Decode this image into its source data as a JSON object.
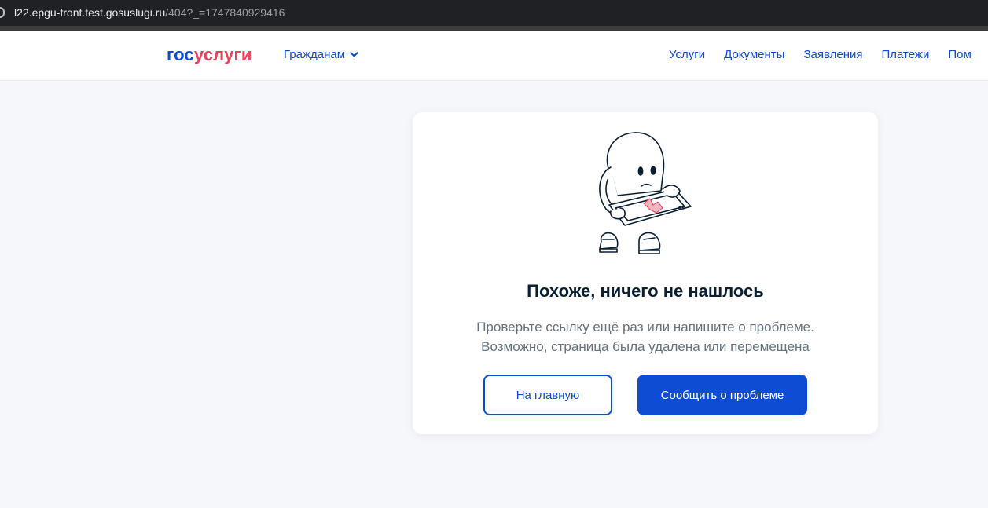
{
  "browser": {
    "url_host": "l22.epgu-front.test.gosuslugi.ru",
    "url_path": "/404?_=1747840929416"
  },
  "header": {
    "logo_part1": "гос",
    "logo_part2": "услуги",
    "citizens_label": "Гражданам",
    "nav": [
      "Услуги",
      "Документы",
      "Заявления",
      "Платежи",
      "Пом"
    ]
  },
  "card": {
    "title": "Похоже, ничего не нашлось",
    "description_line1": "Проверьте ссылку ещё раз или напишите о проблеме.",
    "description_line2": "Возможно, страница была удалена или перемещена",
    "home_button": "На главную",
    "report_button": "Сообщить о проблеме"
  },
  "colors": {
    "primary": "#0d4cd3",
    "logo_red": "#ee3f58",
    "title": "#0b1f33",
    "muted": "#66727f",
    "background": "#f5f7fb"
  },
  "icons": [
    "site-info-icon",
    "chevron-down-icon",
    "not-found-character-illustration"
  ]
}
